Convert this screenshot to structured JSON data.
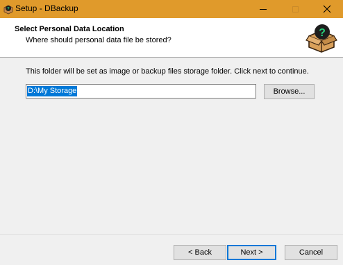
{
  "window": {
    "title": "Setup - DBackup"
  },
  "header": {
    "title": "Select Personal Data Location",
    "subtitle": "Where should personal data file be stored?"
  },
  "body": {
    "instruction": "This folder will be set as image or backup files storage folder. Click next to continue.",
    "path_value": "D:\\My Storage",
    "browse_label": "Browse..."
  },
  "footer": {
    "back_label": "< Back",
    "next_label": "Next >",
    "cancel_label": "Cancel"
  },
  "colors": {
    "titlebar": "#e09a2b",
    "accent": "#0078d7",
    "logo_box": "#d9a05a",
    "logo_circle": "#1e1e1e",
    "logo_glyph": "#27d07a"
  },
  "icons": {
    "app": "dbackup-app-icon",
    "header_logo": "dbackup-box-logo"
  }
}
